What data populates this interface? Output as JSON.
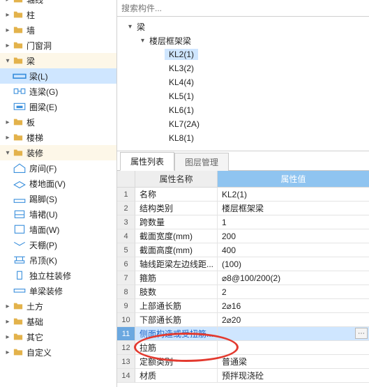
{
  "sidebar": {
    "categories": [
      {
        "label": "轴线",
        "icon": "axis",
        "expanded": false
      },
      {
        "label": "柱",
        "icon": "column",
        "expanded": false
      },
      {
        "label": "墙",
        "icon": "wall",
        "expanded": false
      },
      {
        "label": "门窗洞",
        "icon": "opening",
        "expanded": false
      },
      {
        "label": "梁",
        "icon": "beam",
        "expanded": true,
        "children": [
          {
            "label": "梁(L)",
            "icon": "beam-l",
            "selected": true
          },
          {
            "label": "连梁(G)",
            "icon": "link-beam"
          },
          {
            "label": "圈梁(E)",
            "icon": "ring-beam"
          }
        ]
      },
      {
        "label": "板",
        "icon": "slab",
        "expanded": false
      },
      {
        "label": "楼梯",
        "icon": "stair",
        "expanded": false
      },
      {
        "label": "装修",
        "icon": "finish",
        "expanded": true,
        "children": [
          {
            "label": "房间(F)",
            "icon": "room"
          },
          {
            "label": "楼地面(V)",
            "icon": "floor"
          },
          {
            "label": "踢脚(S)",
            "icon": "skirting"
          },
          {
            "label": "墙裙(U)",
            "icon": "wainscot"
          },
          {
            "label": "墙面(W)",
            "icon": "wallface"
          },
          {
            "label": "天棚(P)",
            "icon": "ceiling"
          },
          {
            "label": "吊顶(K)",
            "icon": "susp-ceiling"
          },
          {
            "label": "独立柱装修",
            "icon": "col-finish"
          },
          {
            "label": "单梁装修",
            "icon": "beam-finish"
          }
        ]
      },
      {
        "label": "土方",
        "icon": "earth",
        "expanded": false
      },
      {
        "label": "基础",
        "icon": "foundation",
        "expanded": false
      },
      {
        "label": "其它",
        "icon": "other",
        "expanded": false
      },
      {
        "label": "自定义",
        "icon": "custom",
        "expanded": false
      }
    ]
  },
  "search_placeholder": "搜索构件...",
  "tree": {
    "root": {
      "label": "梁"
    },
    "group": {
      "label": "楼层框架梁"
    },
    "items": [
      {
        "label": "KL2(1)",
        "selected": true
      },
      {
        "label": "KL3(2)"
      },
      {
        "label": "KL4(4)"
      },
      {
        "label": "KL5(1)"
      },
      {
        "label": "KL6(1)"
      },
      {
        "label": "KL7(2A)"
      },
      {
        "label": "KL8(1)"
      }
    ]
  },
  "tabs": [
    {
      "label": "属性列表",
      "active": true
    },
    {
      "label": "图层管理",
      "active": false
    }
  ],
  "grid": {
    "head_name": "属性名称",
    "head_value": "属性值",
    "rows": [
      {
        "n": "1",
        "name": "名称",
        "value": "KL2(1)"
      },
      {
        "n": "2",
        "name": "结构类别",
        "value": "楼层框架梁"
      },
      {
        "n": "3",
        "name": "跨数量",
        "value": "1"
      },
      {
        "n": "4",
        "name": "截面宽度(mm)",
        "value": "200"
      },
      {
        "n": "5",
        "name": "截面高度(mm)",
        "value": "400"
      },
      {
        "n": "6",
        "name": "轴线距梁左边线距...",
        "value": "(100)"
      },
      {
        "n": "7",
        "name": "箍筋",
        "value": "⌀8@100/200(2)"
      },
      {
        "n": "8",
        "name": "肢数",
        "value": "2"
      },
      {
        "n": "9",
        "name": "上部通长筋",
        "value": "2⌀16"
      },
      {
        "n": "10",
        "name": "下部通长筋",
        "value": "2⌀20"
      },
      {
        "n": "11",
        "name": "侧面构造或受扭筋...",
        "value": "",
        "selected": true,
        "more": true
      },
      {
        "n": "12",
        "name": "拉筋",
        "value": ""
      },
      {
        "n": "13",
        "name": "定额类别",
        "value": "普通梁"
      },
      {
        "n": "14",
        "name": "材质",
        "value": "预拌现浇砼"
      }
    ]
  },
  "icon_colors": {
    "folder": "#e3b24b",
    "beam_l": "#3a8fdc",
    "room": "#3a8fdc",
    "earth": "#d08a3a"
  }
}
